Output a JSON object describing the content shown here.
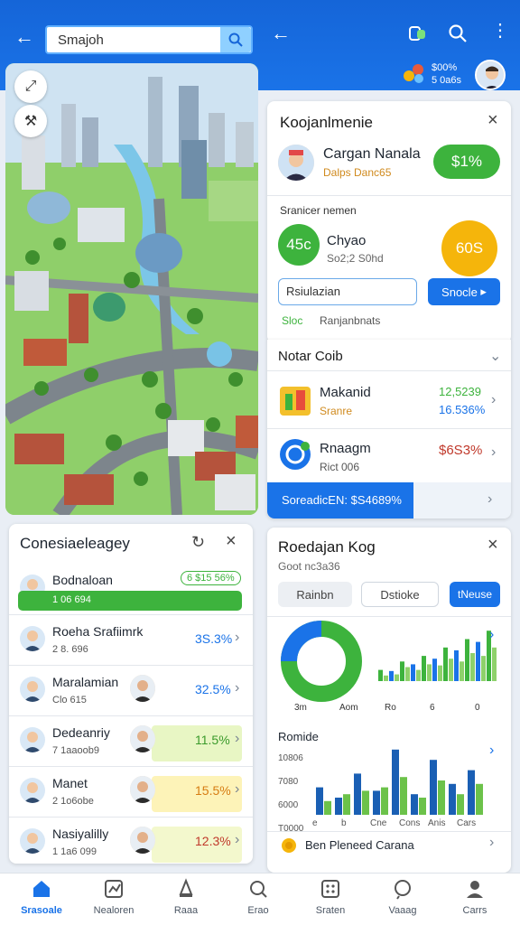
{
  "search": {
    "value": "Smajoh"
  },
  "header": {
    "badge_line1": "$00%",
    "badge_line2": "5 0a6s"
  },
  "profile_card": {
    "title": "Koojanlmenie",
    "name": "Cargan Nanala",
    "subtitle": "Dalps Danc65",
    "score": "$1%",
    "section_label": "Sranicer nemen",
    "metric_left": "45c",
    "metric_name": "Chyao",
    "metric_sub": "So2;2 S0hd",
    "metric_right": "60S",
    "input_value": "Rsiulazian",
    "button_label": "Snocle",
    "link1": "Sloc",
    "link2": "Ranjanbnats"
  },
  "notar": {
    "title": "Notar Coib",
    "items": [
      {
        "name": "Makanid",
        "sub": "Sranre",
        "v1": "12,5239",
        "v2": "16.536%"
      },
      {
        "name": "Rnaagm",
        "sub": "Rict 006",
        "v1": "$6S3%",
        "v2": ""
      }
    ],
    "bar_label": "SoreadicEN: $S4689%"
  },
  "left_list": {
    "title": "Conesiaeleagey",
    "items": [
      {
        "name": "Bodnaloan",
        "sub": "1 06 694",
        "value": "6 $15 56%"
      },
      {
        "name": "Roeha Srafiimrk",
        "sub": "2 8. 696",
        "value": "3S.3%"
      },
      {
        "name": "Maralamian",
        "sub": "Clo 615",
        "value": "32.5%"
      },
      {
        "name": "Dedeanriy",
        "sub": "7 1aaoob9",
        "value": "11.5%"
      },
      {
        "name": "Manet",
        "sub": "2 1o6obe",
        "value": "15.5%"
      },
      {
        "name": "Nasiyalilly",
        "sub": "1 1a6 099",
        "value": "12.3%"
      }
    ]
  },
  "analytics": {
    "title": "Roedajan Kog",
    "subtitle": "Goot nc3a36",
    "chip1": "Rainbn",
    "chip2": "Dstioke",
    "chip3": "tNeuse",
    "x_labels": [
      "3m",
      "Aom",
      "Ro",
      "6",
      "0"
    ],
    "section2": "Romide",
    "y_labels": [
      "10806",
      "7080",
      "6000",
      "T0000"
    ],
    "x2_labels": [
      "e",
      "b",
      "Cne",
      "Cons",
      "Anis",
      "Cars"
    ],
    "footer": "Ben Pleneed Carana"
  },
  "chart_data": [
    {
      "type": "bar",
      "title": "",
      "series": [
        {
          "values": [
            20,
            18,
            35,
            30,
            45,
            40,
            60,
            55,
            75,
            70,
            90
          ]
        },
        {
          "values": [
            10,
            12,
            25,
            20,
            30,
            28,
            40,
            35,
            50,
            45,
            60
          ]
        }
      ]
    },
    {
      "type": "bar",
      "title": "Romide",
      "series": [
        {
          "values": [
            40,
            25,
            60,
            35,
            95,
            30,
            80,
            45,
            65
          ]
        },
        {
          "values": [
            20,
            30,
            35,
            40,
            55,
            25,
            50,
            30,
            45
          ]
        }
      ]
    }
  ],
  "bottom_nav": [
    {
      "label": "Srasoale",
      "active": true
    },
    {
      "label": "Nealoren"
    },
    {
      "label": "Raaa"
    },
    {
      "label": "Erao"
    },
    {
      "label": "Sraten"
    },
    {
      "label": "Vaaag"
    },
    {
      "label": "Carrs"
    }
  ],
  "colors": {
    "primary": "#1a73e8",
    "green": "#3db33d",
    "amber": "#f5b50b"
  }
}
